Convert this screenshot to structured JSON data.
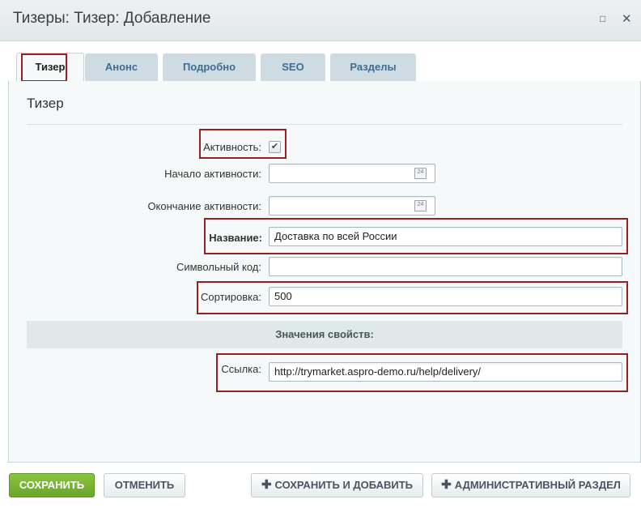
{
  "window": {
    "title": "Тизеры: Тизер: Добавление",
    "maximize_icon": "□",
    "close_icon": "✕"
  },
  "tabs": [
    {
      "label": "Тизер",
      "active": true
    },
    {
      "label": "Анонс",
      "active": false
    },
    {
      "label": "Подробно",
      "active": false
    },
    {
      "label": "SEO",
      "active": false
    },
    {
      "label": "Разделы",
      "active": false
    }
  ],
  "section": {
    "title": "Тизер"
  },
  "fields": {
    "active": {
      "label": "Активность:",
      "checked": true,
      "check_glyph": "✔"
    },
    "active_from": {
      "label": "Начало активности:",
      "value": "",
      "calendar_text": "24"
    },
    "active_to": {
      "label": "Окончание активности:",
      "value": "",
      "calendar_text": "24"
    },
    "name": {
      "label": "Название:",
      "value": "Доставка по всей России"
    },
    "code": {
      "label": "Символьный код:",
      "value": ""
    },
    "sort": {
      "label": "Сортировка:",
      "value": "500"
    }
  },
  "properties": {
    "header": "Значения свойств:",
    "link": {
      "label": "Ссылка:",
      "value": "http://trymarket.aspro-demo.ru/help/delivery/"
    }
  },
  "buttons": {
    "save": "СОХРАНИТЬ",
    "cancel": "ОТМЕНИТЬ",
    "save_and_add": "СОХРАНИТЬ И ДОБАВИТЬ",
    "admin_section": "АДМИНИСТРАТИВНЫЙ РАЗДЕЛ",
    "plus_icon": "✚"
  },
  "colors": {
    "highlight": "#9b1f1f",
    "save_button": "#7ab536",
    "tab_inactive": "#cfdbe3",
    "tab_text": "#3e6d91"
  }
}
